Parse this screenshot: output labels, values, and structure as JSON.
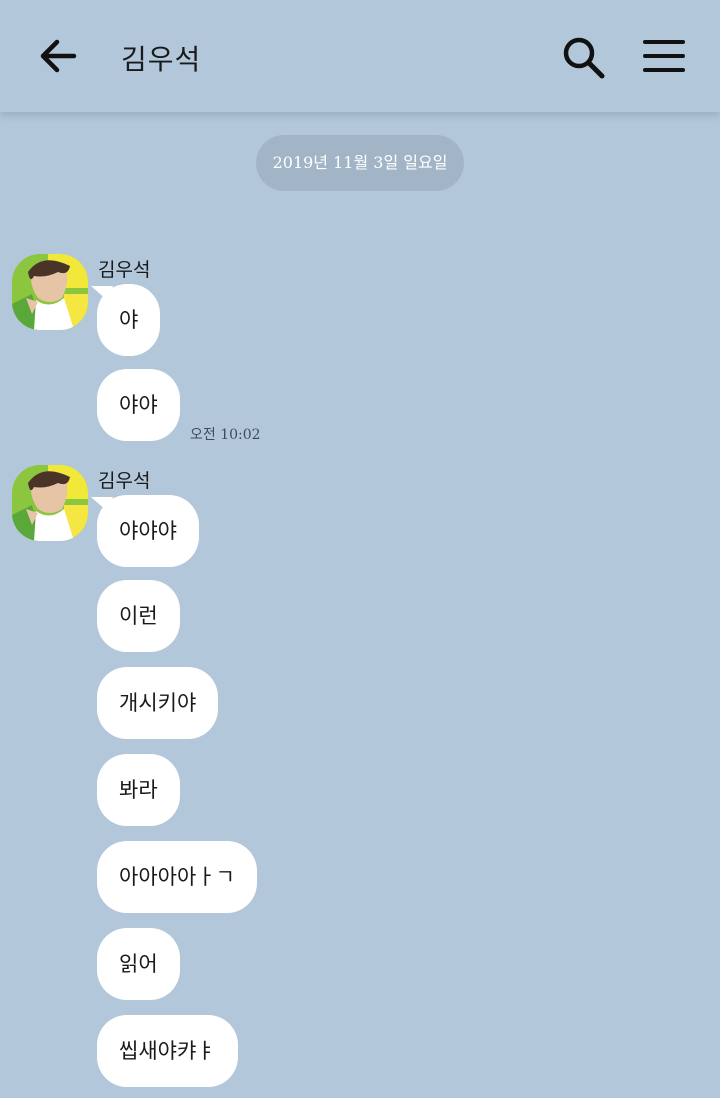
{
  "header": {
    "title": "김우석",
    "back_icon": "arrow-left-icon",
    "search_icon": "search-icon",
    "menu_icon": "hamburger-menu-icon"
  },
  "date_divider": "2019년 11월 3일 일요일",
  "groups": [
    {
      "sender": "김우석",
      "messages": [
        "야",
        "야야"
      ],
      "time": "오전 10:02"
    },
    {
      "sender": "김우석",
      "messages": [
        "야야야",
        "이런",
        "개시키야",
        "봐라",
        "아아아아ㅏㄱ",
        "읽어",
        "씹새야캬ㅑ"
      ]
    }
  ],
  "colors": {
    "background": "#b2c7da",
    "bubble": "#ffffff",
    "date_pill": "#a1b5c7"
  }
}
